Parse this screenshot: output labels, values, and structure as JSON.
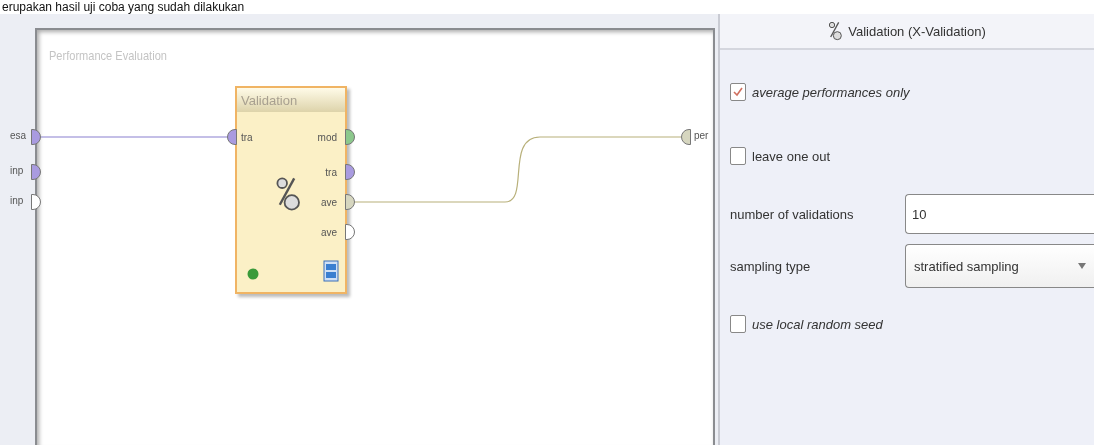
{
  "caption": "erupakan hasil uji coba yang sudah dilakukan",
  "process": {
    "title": "Performance Evaluation",
    "inputs": [
      {
        "label": "esa",
        "color": "#a99be0"
      },
      {
        "label": "inp",
        "color": "#a99be0"
      },
      {
        "label": "inp",
        "color": "#ffffff"
      }
    ],
    "operator": {
      "title": "Validation",
      "inputs": [
        {
          "label": "tra",
          "color": "#a99be0"
        }
      ],
      "outputs": [
        {
          "label": "mod",
          "color": "#8cc88c"
        },
        {
          "label": "tra",
          "color": "#a99be0"
        },
        {
          "label": "ave",
          "color": "#d6d6bf"
        },
        {
          "label": "ave",
          "color": "#ffffff"
        }
      ]
    },
    "outputs": [
      {
        "label": "per",
        "color": "#d6d6bf"
      }
    ]
  },
  "panel": {
    "title": "Validation (X-Validation)",
    "params": [
      {
        "kind": "checkbox",
        "label": "average performances only",
        "checked": true,
        "expert": true
      },
      {
        "kind": "checkbox",
        "label": "leave one out",
        "checked": false,
        "expert": false
      },
      {
        "kind": "text",
        "label": "number of validations",
        "value": "10"
      },
      {
        "kind": "select",
        "label": "sampling type",
        "value": "stratified sampling"
      },
      {
        "kind": "checkbox",
        "label": "use local random seed",
        "checked": false,
        "expert": true
      }
    ]
  }
}
